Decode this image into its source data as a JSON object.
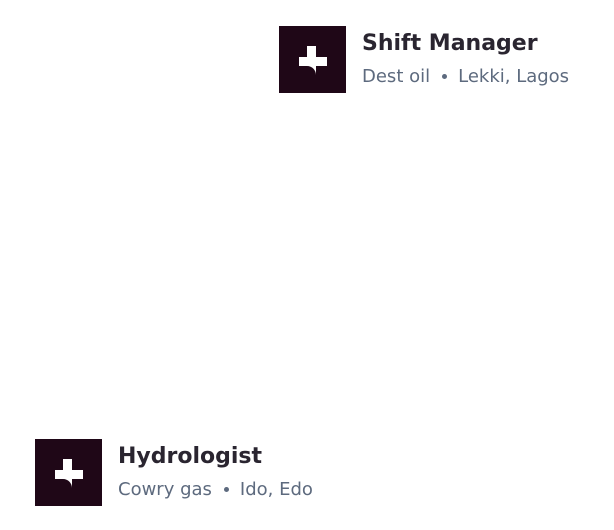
{
  "jobs": [
    {
      "title": "Shift Manager",
      "company": "Dest oil",
      "location": "Lekki, Lagos",
      "logo_icon": "cross-logo-icon"
    },
    {
      "title": "Hydrologist",
      "company": "Cowry gas",
      "location": "Ido, Edo",
      "logo_icon": "cross-logo-icon"
    }
  ],
  "colors": {
    "logo_bg": "#1f0717",
    "title": "#2a2530",
    "meta": "#5d6a7e",
    "background": "#ffffff"
  }
}
